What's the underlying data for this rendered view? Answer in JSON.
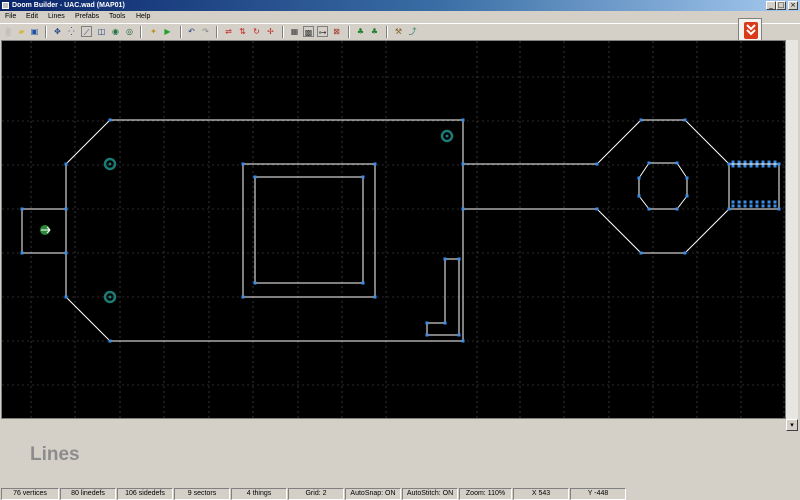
{
  "window": {
    "title": "Doom Builder - UAC.wad (MAP01)",
    "minimize": "_",
    "maximize": "□",
    "close": "×"
  },
  "menu": {
    "items": [
      "File",
      "Edit",
      "Lines",
      "Prefabs",
      "Tools",
      "Help"
    ]
  },
  "toolbar": {
    "icons": [
      "new-icon",
      "open-icon",
      "save-icon",
      "move-mode-icon",
      "vertices-mode-icon",
      "lines-mode-icon",
      "sectors-mode-icon",
      "things-mode-icon",
      "3d-mode-icon",
      "test-map-icon",
      "undo-icon",
      "redo-icon",
      "flip-horizontal-icon",
      "flip-vertical-icon",
      "rotate-icon",
      "resize-icon",
      "grid-icon",
      "snap-icon",
      "stitch-icon",
      "map-options-icon",
      "tree-icon",
      "trees-icon",
      "find-icon",
      "errors-icon"
    ]
  },
  "editor": {
    "mode": "Lines"
  },
  "status": {
    "vertices": "76 vertices",
    "linedefs": "80 linedefs",
    "sidedefs": "106 sidedefs",
    "sectors": "9 sectors",
    "things": "4 things",
    "grid": "Grid: 2",
    "autosnap": "AutoSnap: ON",
    "autostitch": "AutoStitch: ON",
    "zoom": "Zoom: 110%",
    "x": "X 543",
    "y": "Y -448"
  },
  "colors": {
    "line": "#ffffff",
    "vertex": "#3a8ee8",
    "thing": "#1d7a74",
    "grid": "#555555",
    "background": "#000000"
  }
}
